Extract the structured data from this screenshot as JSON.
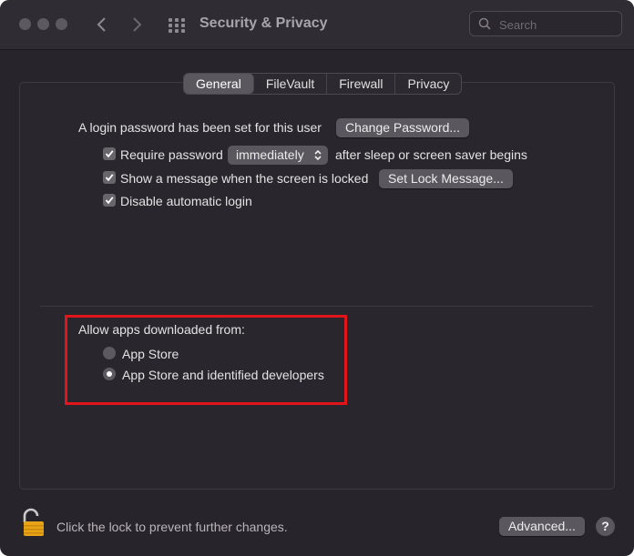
{
  "window": {
    "title": "Security & Privacy"
  },
  "search": {
    "placeholder": "Search"
  },
  "tabs": [
    {
      "label": "General",
      "active": true
    },
    {
      "label": "FileVault",
      "active": false
    },
    {
      "label": "Firewall",
      "active": false
    },
    {
      "label": "Privacy",
      "active": false
    }
  ],
  "general": {
    "login_text": "A login password has been set for this user",
    "change_password": "Change Password...",
    "require_password": {
      "label": "Require password",
      "checked": true,
      "select_value": "immediately",
      "suffix": "after sleep or screen saver begins"
    },
    "show_message": {
      "label": "Show a message when the screen is locked",
      "checked": true,
      "button": "Set Lock Message..."
    },
    "disable_login": {
      "label": "Disable automatic login",
      "checked": true
    }
  },
  "downloads": {
    "heading": "Allow apps downloaded from:",
    "options": [
      {
        "label": "App Store",
        "selected": false
      },
      {
        "label": "App Store and identified developers",
        "selected": true
      }
    ]
  },
  "footer": {
    "lock_text": "Click the lock to prevent further changes.",
    "advanced": "Advanced...",
    "help": "?"
  },
  "colors": {
    "highlight": "#e2151b",
    "lock": "#e8a317"
  }
}
